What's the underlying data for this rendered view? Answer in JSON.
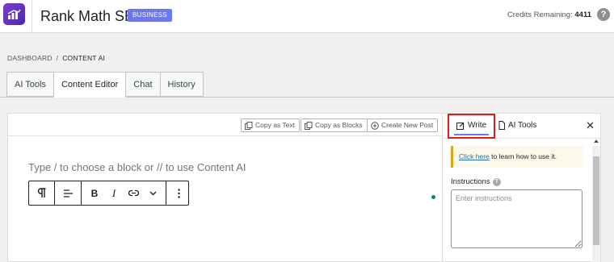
{
  "header": {
    "app_title": "Rank Math SEO",
    "plan_badge": "BUSINESS",
    "credits_label": "Credits Remaining:",
    "credits_value": "4411",
    "help_symbol": "?"
  },
  "breadcrumb": {
    "items": [
      "DASHBOARD",
      "CONTENT AI"
    ],
    "separator": "/"
  },
  "tabs": [
    {
      "label": "AI Tools"
    },
    {
      "label": "Content Editor",
      "active": true
    },
    {
      "label": "Chat"
    },
    {
      "label": "History"
    }
  ],
  "editor": {
    "toolbar": {
      "copy_text": "Copy as Text",
      "copy_blocks": "Copy as Blocks",
      "new_post": "Create New Post"
    },
    "placeholder": "Type / to choose a block or // to use Content AI",
    "block_toolbar": [
      "paragraph-icon",
      "align-icon",
      "bold-icon",
      "italic-icon",
      "link-icon",
      "chevron-down-icon",
      "more-options-icon"
    ]
  },
  "sidebar": {
    "tabs": {
      "write": "Write",
      "ai_tools": "AI Tools"
    },
    "close": "✕",
    "notice": {
      "link_text": "Click here",
      "text": " to learn how to use it."
    },
    "instructions_label": "Instructions",
    "instructions_placeholder": "Enter instructions"
  },
  "colors": {
    "accent": "#6e77f2",
    "highlight_box": "#e01b1b",
    "notice_border": "#dba617",
    "status_dot": "#0a875a"
  }
}
